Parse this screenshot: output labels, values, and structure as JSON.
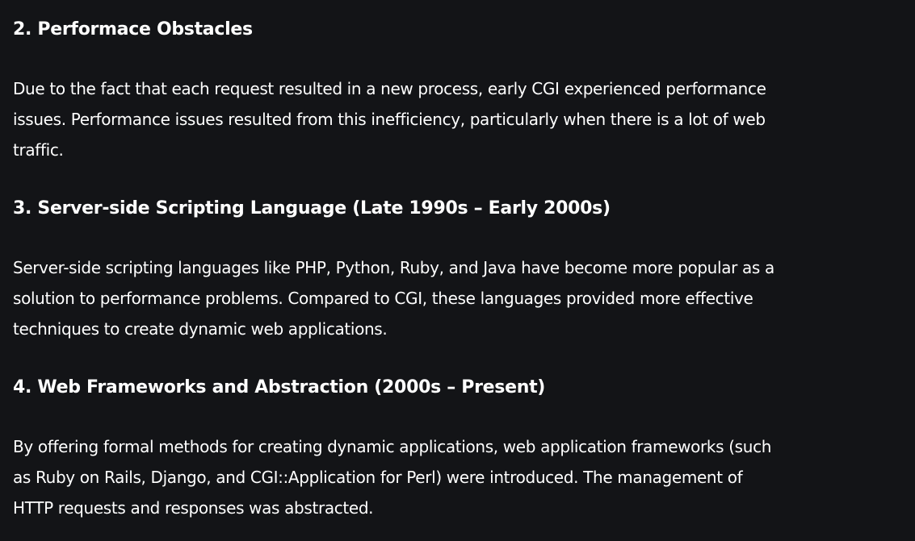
{
  "sections": [
    {
      "heading": "2. Performace Obstacles",
      "lines": [
        "Due to the fact that each request resulted in a new process, early CGI experienced performance",
        "issues. Performance issues resulted from this inefficiency, particularly when there is a lot of web",
        "traffic."
      ]
    },
    {
      "heading": "3. Server-side Scripting Language (Late 1990s – Early 2000s)",
      "lines": [
        "Server-side scripting languages like PHP, Python, Ruby, and Java have become more popular as a",
        "solution to performance problems. Compared to CGI, these languages provided more effective",
        "techniques to create dynamic web applications."
      ]
    },
    {
      "heading": "4. Web Frameworks and Abstraction (2000s – Present)",
      "lines": [
        "By offering formal methods for creating dynamic applications, web application frameworks (such",
        "as Ruby on Rails, Django, and CGI::Application for Perl) were introduced. The management of",
        "HTTP requests and responses was abstracted."
      ]
    }
  ]
}
